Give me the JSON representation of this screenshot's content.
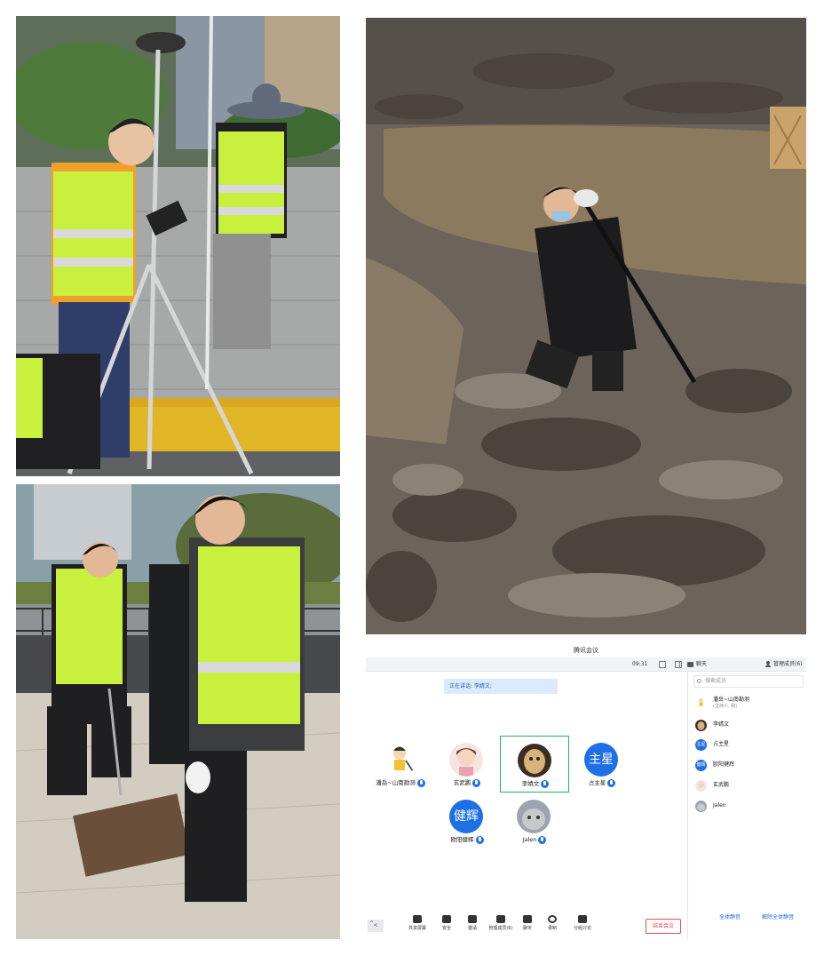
{
  "meeting": {
    "title": "腾讯会议",
    "clock": "09:31",
    "chat_tab": "聊天",
    "members_tab": "管理成员(6)",
    "speaking": "正在讲话: 李婧文;",
    "search_placeholder": "搜索成员",
    "tiles": [
      {
        "name": "潘岳~山南勘测",
        "avatar": "cartoon"
      },
      {
        "name": "玄武鹏",
        "avatar": "doll"
      },
      {
        "name": "李婧文",
        "avatar": "cat-photo",
        "active": true
      },
      {
        "name": "占主星",
        "avatar_text": "主星"
      },
      {
        "name": "欧阳健辉",
        "avatar_text": "健辉"
      },
      {
        "name": "Jalen",
        "avatar": "cat-gray"
      }
    ],
    "members": [
      {
        "name": "潘岳~山南勘测",
        "sub": "(主持人, 我)"
      },
      {
        "name": "李婧文"
      },
      {
        "name": "占主星",
        "avatar_text": "主星"
      },
      {
        "name": "欧阳健辉",
        "avatar_text": "健辉"
      },
      {
        "name": "玄武鹏"
      },
      {
        "name": "Jalen"
      }
    ],
    "toolbar": [
      {
        "label": "共享屏幕",
        "icon": "screen-share-icon"
      },
      {
        "label": "安全",
        "icon": "shield-icon"
      },
      {
        "label": "邀请",
        "icon": "invite-icon"
      },
      {
        "label": "管理成员(6)",
        "icon": "members-icon"
      },
      {
        "label": "聊天",
        "icon": "chat-icon"
      },
      {
        "label": "录制",
        "icon": "record-icon"
      },
      {
        "label": "分组讨论",
        "icon": "breakout-icon"
      }
    ],
    "end_label": "结束会议",
    "mute_all": "全体静音",
    "unmute_all": "解除全体静音"
  },
  "colors": {
    "accent": "#1f6fe6",
    "active_border": "#20b35a",
    "end_red": "#e84a4a",
    "vest": "#c8f03c"
  }
}
